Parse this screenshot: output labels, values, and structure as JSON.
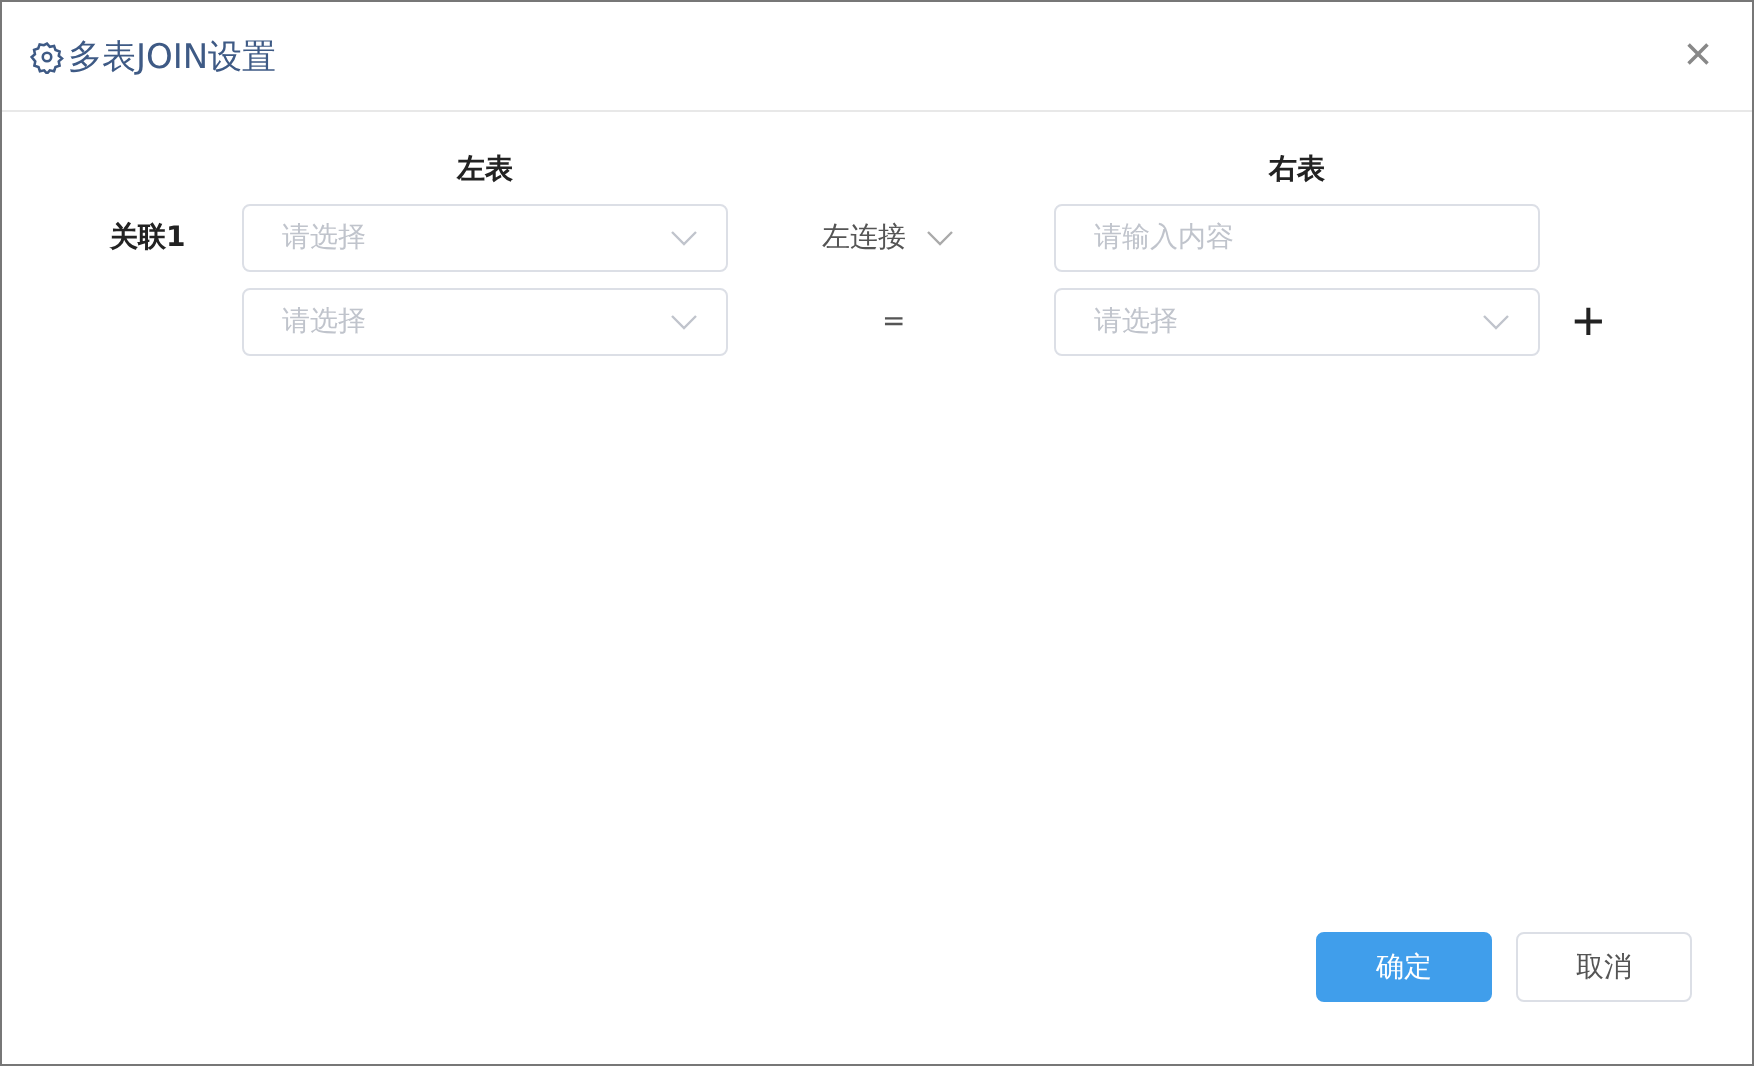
{
  "dialog": {
    "title": "多表JOIN设置",
    "close": "×"
  },
  "headers": {
    "left": "左表",
    "right": "右表"
  },
  "relation": {
    "label": "关联1",
    "rows": [
      {
        "left": {
          "placeholder": "请选择"
        },
        "operator": {
          "kind": "dropdown",
          "text": "左连接"
        },
        "right": {
          "kind": "input",
          "placeholder": "请输入内容"
        }
      },
      {
        "left": {
          "placeholder": "请选择"
        },
        "operator": {
          "kind": "text",
          "text": "="
        },
        "right": {
          "kind": "select",
          "placeholder": "请选择"
        }
      }
    ],
    "add": "+"
  },
  "buttons": [
    {
      "label": "确定",
      "kind": "primary"
    },
    {
      "label": "取消",
      "kind": "default"
    }
  ]
}
